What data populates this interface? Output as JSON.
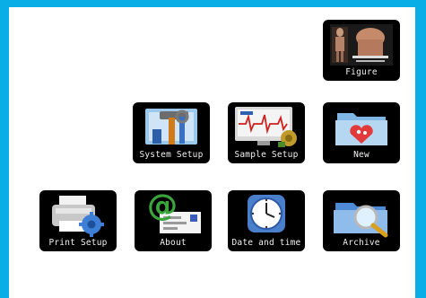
{
  "tiles": {
    "figure": {
      "label": "Figure",
      "icon": "body-figure-icon"
    },
    "system_setup": {
      "label": "System Setup",
      "icon": "tools-icon"
    },
    "sample_setup": {
      "label": "Sample Setup",
      "icon": "ecg-monitor-icon"
    },
    "new": {
      "label": "New",
      "icon": "new-folder-icon"
    },
    "print_setup": {
      "label": "Print Setup",
      "icon": "printer-gear-icon"
    },
    "about": {
      "label": "About",
      "icon": "at-sign-icon"
    },
    "date_and_time": {
      "label": "Date and time",
      "icon": "clock-icon"
    },
    "archive": {
      "label": "Archive",
      "icon": "archive-search-icon"
    }
  },
  "colors": {
    "background": "#0aaee6",
    "tile": "#000000",
    "label": "#f2f2f2"
  }
}
